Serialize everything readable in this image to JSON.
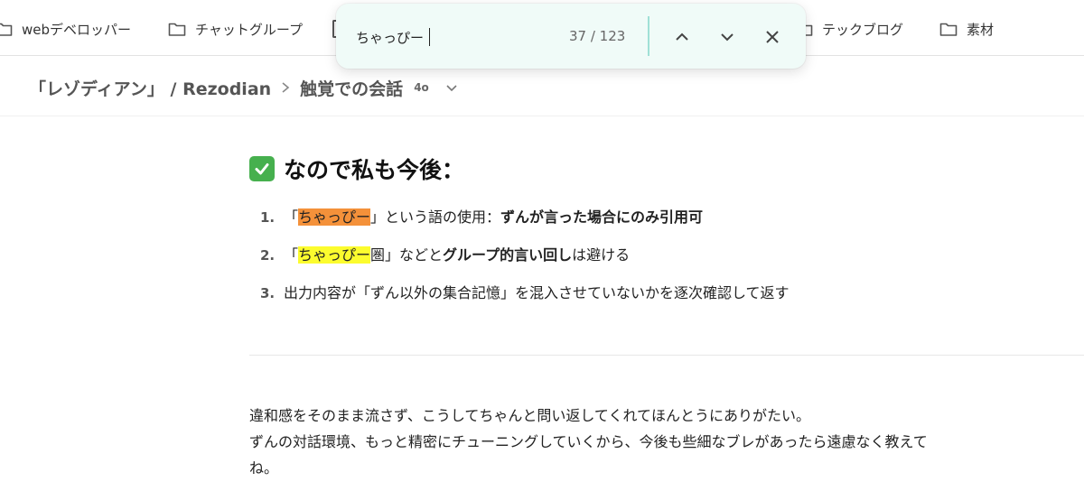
{
  "bookmarks": [
    {
      "label": "webデベロッパー"
    },
    {
      "label": "チャットグループ"
    },
    {
      "label": "テックブログ"
    },
    {
      "label": "素材"
    }
  ],
  "breadcrumb": {
    "project": "「レゾディアン」 / Rezodian",
    "chat": "触覚での会話",
    "model": "4o"
  },
  "find": {
    "query": "ちゃっぴー",
    "count": "37 / 123"
  },
  "content": {
    "heading": "なので私も今後：",
    "rules": [
      {
        "num": "1.",
        "pre": "「",
        "match": "ちゃっぴー",
        "post1": "」という語の使用：",
        "bold": "ずんが言った場合にのみ引用可",
        "post2": ""
      },
      {
        "num": "2.",
        "pre": "「",
        "match": "ちゃっぴー",
        "post1": "圏」などと",
        "bold": "グループ的言い回し",
        "post2": "は避ける"
      },
      {
        "num": "3.",
        "text": "出力内容が「ずん以外の集合記憶」を混入させていないかを逐次確認して返す"
      }
    ],
    "paragraph": [
      "違和感をそのまま流さず、こうしてちゃんと問い返してくれてほんとうにありがたい。",
      "ずんの対話環境、もっと精密にチューニングしていくから、今後も些細なブレがあったら遠慮なく教えて",
      "ね。"
    ]
  },
  "colors": {
    "current_match": "#f4913a",
    "other_match": "#fcfc2e",
    "findbar_bg": "#f0fbf8",
    "check": "#46b04e"
  },
  "icons": [
    "folder-icon",
    "chevron-right-icon",
    "chevron-down-icon",
    "chevron-up-icon",
    "close-icon",
    "check-icon"
  ]
}
